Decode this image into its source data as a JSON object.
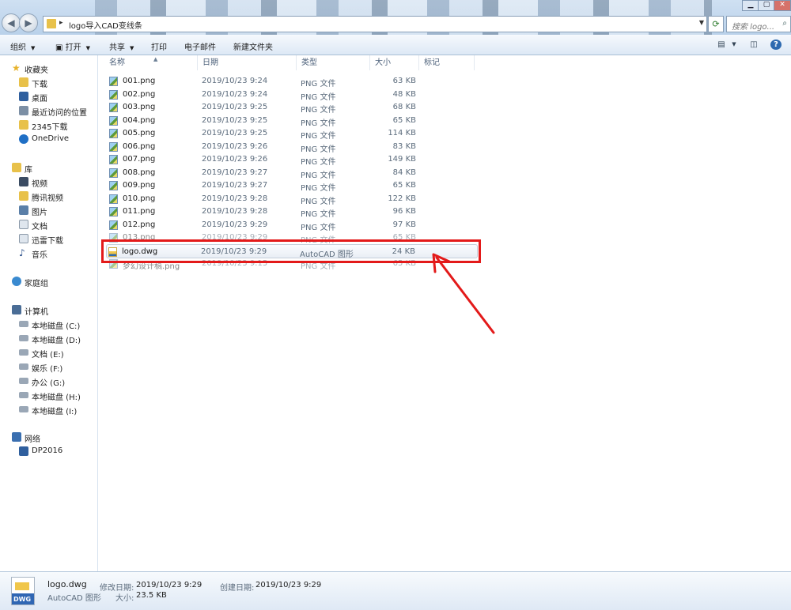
{
  "address": {
    "path": "logo导入CAD变线条"
  },
  "search": {
    "placeholder": "搜索 logo..."
  },
  "toolbar": {
    "organize": "组织",
    "open": "打开",
    "share": "共享",
    "print": "打印",
    "email": "电子邮件",
    "new_folder": "新建文件夹"
  },
  "sidebar": {
    "favorites": "收藏夹",
    "fav_items": [
      "下载",
      "桌面",
      "最近访问的位置",
      "2345下载",
      "OneDrive"
    ],
    "libraries": "库",
    "lib_items": [
      "视频",
      "腾讯视频",
      "图片",
      "文档",
      "迅雷下载",
      "音乐"
    ],
    "homegroup": "家庭组",
    "computer": "计算机",
    "drives": [
      "本地磁盘 (C:)",
      "本地磁盘 (D:)",
      "文档 (E:)",
      "娱乐 (F:)",
      "办公 (G:)",
      "本地磁盘 (H:)",
      "本地磁盘 (I:)"
    ],
    "network": "网络",
    "net_items": [
      "DP2016"
    ]
  },
  "columns": {
    "name": "名称",
    "date": "日期",
    "type": "类型",
    "size": "大小",
    "tags": "标记"
  },
  "files": [
    {
      "name": "001.png",
      "date": "2019/10/23 9:24",
      "type": "PNG 文件",
      "size": "63 KB"
    },
    {
      "name": "002.png",
      "date": "2019/10/23 9:24",
      "type": "PNG 文件",
      "size": "48 KB"
    },
    {
      "name": "003.png",
      "date": "2019/10/23 9:25",
      "type": "PNG 文件",
      "size": "68 KB"
    },
    {
      "name": "004.png",
      "date": "2019/10/23 9:25",
      "type": "PNG 文件",
      "size": "65 KB"
    },
    {
      "name": "005.png",
      "date": "2019/10/23 9:25",
      "type": "PNG 文件",
      "size": "114 KB"
    },
    {
      "name": "006.png",
      "date": "2019/10/23 9:26",
      "type": "PNG 文件",
      "size": "83 KB"
    },
    {
      "name": "007.png",
      "date": "2019/10/23 9:26",
      "type": "PNG 文件",
      "size": "149 KB"
    },
    {
      "name": "008.png",
      "date": "2019/10/23 9:27",
      "type": "PNG 文件",
      "size": "84 KB"
    },
    {
      "name": "009.png",
      "date": "2019/10/23 9:27",
      "type": "PNG 文件",
      "size": "65 KB"
    },
    {
      "name": "010.png",
      "date": "2019/10/23 9:28",
      "type": "PNG 文件",
      "size": "122 KB"
    },
    {
      "name": "011.png",
      "date": "2019/10/23 9:28",
      "type": "PNG 文件",
      "size": "96 KB"
    },
    {
      "name": "012.png",
      "date": "2019/10/23 9:29",
      "type": "PNG 文件",
      "size": "97 KB"
    },
    {
      "name": "013.png",
      "date": "2019/10/23 9:29",
      "type": "PNG 文件",
      "size": "65 KB"
    },
    {
      "name": "logo.dwg",
      "date": "2019/10/23 9:29",
      "type": "AutoCAD 图形",
      "size": "24 KB"
    },
    {
      "name": "梦幻设计稿.png",
      "date": "2019/10/23 9:15",
      "type": "PNG 文件",
      "size": "65 KB"
    }
  ],
  "details": {
    "name": "logo.dwg",
    "type": "AutoCAD 图形",
    "modified_label": "修改日期:",
    "modified": "2019/10/23 9:29",
    "size_label": "大小:",
    "size": "23.5 KB",
    "created_label": "创建日期:",
    "created": "2019/10/23 9:29",
    "icon_text": "DWG"
  },
  "colors": {
    "highlight": "#e31a1a",
    "arrow": "#e31a1a"
  }
}
